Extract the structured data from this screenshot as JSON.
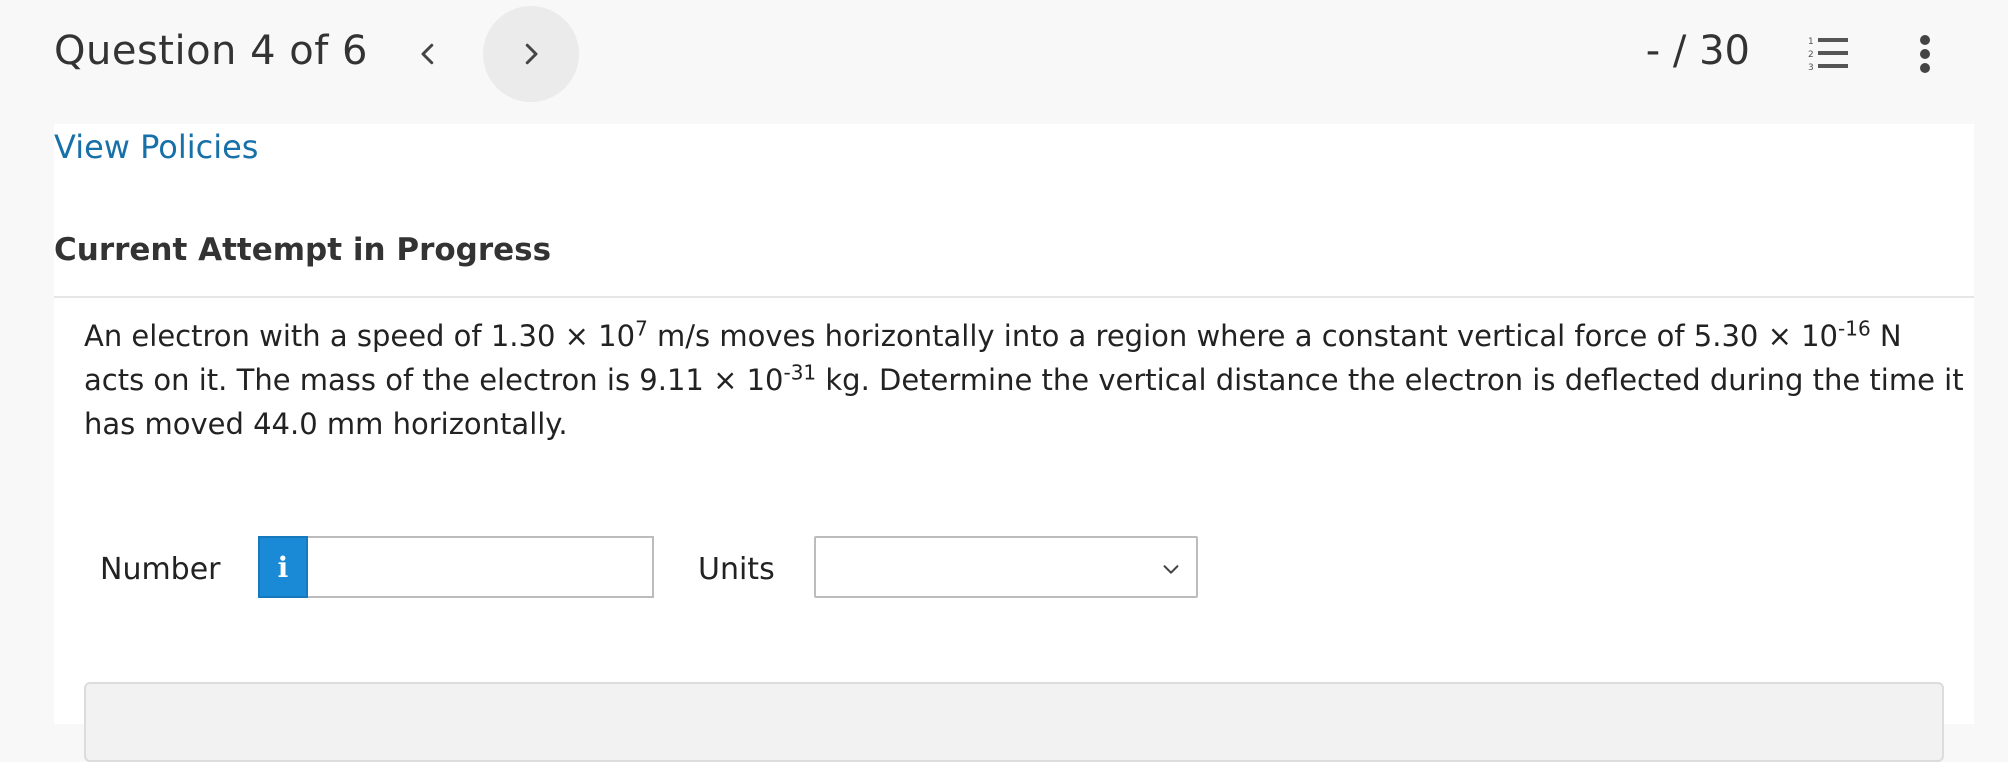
{
  "header": {
    "question_counter": "Question 4 of 6",
    "score": "- / 30",
    "prev_icon": "chevron-left-icon",
    "next_icon": "chevron-right-icon",
    "list_icon": "numbered-list-icon",
    "more_icon": "vertical-ellipsis-icon"
  },
  "links": {
    "view_policies": "View Policies"
  },
  "attempt": {
    "heading": "Current Attempt in Progress"
  },
  "question": {
    "seg1": "An electron with a speed of 1.30 × 10",
    "sup1": "7",
    "seg2": " m/s moves horizontally into a region where a constant vertical force of 5.30 × 10",
    "sup2": "-16",
    "seg3": " N acts on it. The mass of the electron is 9.11 × 10",
    "sup3": "-31",
    "seg4": " kg. Determine the vertical distance the electron is deflected during the time it has moved 44.0 mm horizontally."
  },
  "answer": {
    "number_label": "Number",
    "number_value": "",
    "info_icon": "info-icon",
    "units_label": "Units",
    "units_value": ""
  },
  "colors": {
    "link": "#1770a8",
    "info_button": "#1a8ad6"
  }
}
